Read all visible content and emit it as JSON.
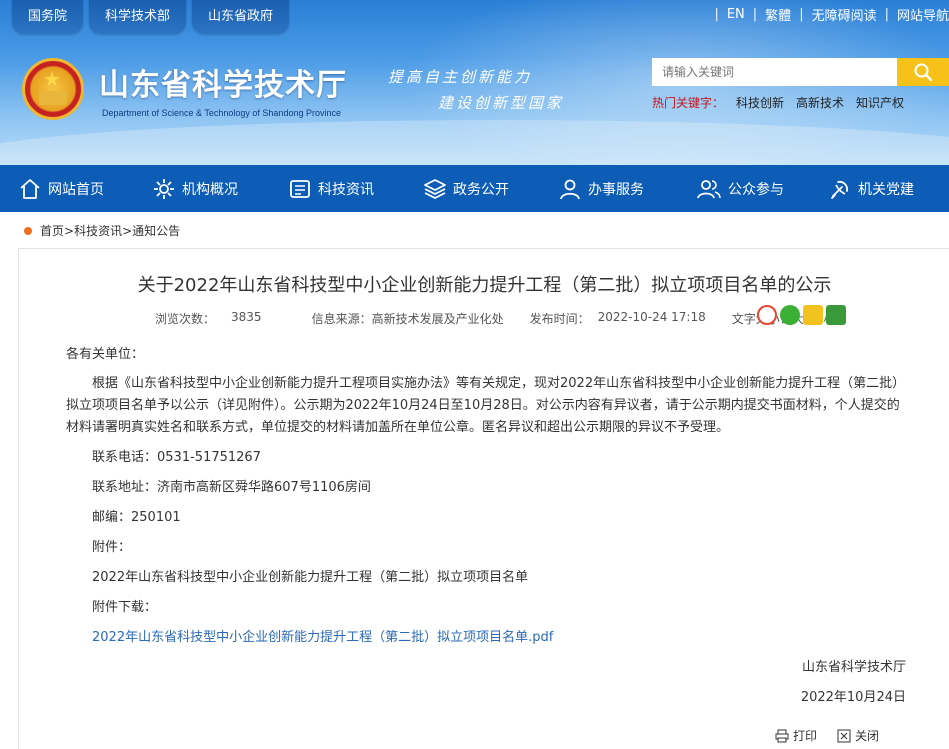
{
  "top": {
    "tabs": [
      "国务院",
      "科学技术部",
      "山东省政府"
    ],
    "links": [
      "EN",
      "繁體",
      "无障碍阅读",
      "网站导航"
    ]
  },
  "brand": {
    "title": "山东省科学技术厅",
    "subtitle": "Department of Science & Technology of Shandong Province",
    "slogan_line1": "提高自主创新能力",
    "slogan_line2": "建设创新型国家"
  },
  "search": {
    "placeholder": "请输入关键词",
    "hot_label": "热门关键字：",
    "hot_keywords": [
      "科技创新",
      "高新技术",
      "知识产权"
    ]
  },
  "nav": {
    "items": [
      "网站首页",
      "机构概况",
      "科技资讯",
      "政务公开",
      "办事服务",
      "公众参与",
      "机关党建"
    ]
  },
  "breadcrumb": {
    "items": [
      "首页",
      "科技资讯",
      "通知公告"
    ],
    "separator": ">"
  },
  "article": {
    "title": "关于2022年山东省科技型中小企业创新能力提升工程（第二批）拟立项项目名单的公示",
    "views_label": "浏览次数：",
    "views": "3835",
    "source_label": "信息来源：",
    "source": "高新技术发展及产业化处",
    "date_label": "发布时间：",
    "date": "2022-10-24 17:18",
    "fontsize_label": "文字大小：",
    "fontsize_options": "大 中 小",
    "greeting": "各有关单位：",
    "paragraph": "根据《山东省科技型中小企业创新能力提升工程项目实施办法》等有关规定，现对2022年山东省科技型中小企业创新能力提升工程（第二批）拟立项项目名单予以公示（详见附件）。公示期为2022年10月24日至10月28日。对公示内容有异议者，请于公示期内提交书面材料，个人提交的材料请署明真实姓名和联系方式，单位提交的材料请加盖所在单位公章。匿名异议和超出公示期限的异议不予受理。",
    "phone": "联系电话：0531-51751267",
    "address": "联系地址：济南市高新区舜华路607号1106房间",
    "postcode": "邮编：250101",
    "attachment_label": "附件：",
    "attachment_name": "2022年山东省科技型中小企业创新能力提升工程（第二批）拟立项项目名单",
    "download_label": "附件下载：",
    "download_link": "2022年山东省科技型中小企业创新能力提升工程（第二批）拟立项项目名单.pdf",
    "signature": "山东省科学技术厅",
    "sign_date": "2022年10月24日",
    "print_label": "打印",
    "close_label": "关闭"
  },
  "colors": {
    "nav_bg": "#0d5cb5",
    "search_button": "#f6c21a",
    "hot_label": "#c4161c",
    "link": "#2a6ab8",
    "crumb_dot": "#f07020"
  },
  "icons": {
    "nav": [
      "home-icon",
      "org-icon",
      "news-icon",
      "layers-icon",
      "user-icon",
      "group-icon",
      "party-icon"
    ],
    "share": [
      "weibo-icon",
      "wechat-icon",
      "qzone-icon",
      "douban-icon"
    ]
  }
}
